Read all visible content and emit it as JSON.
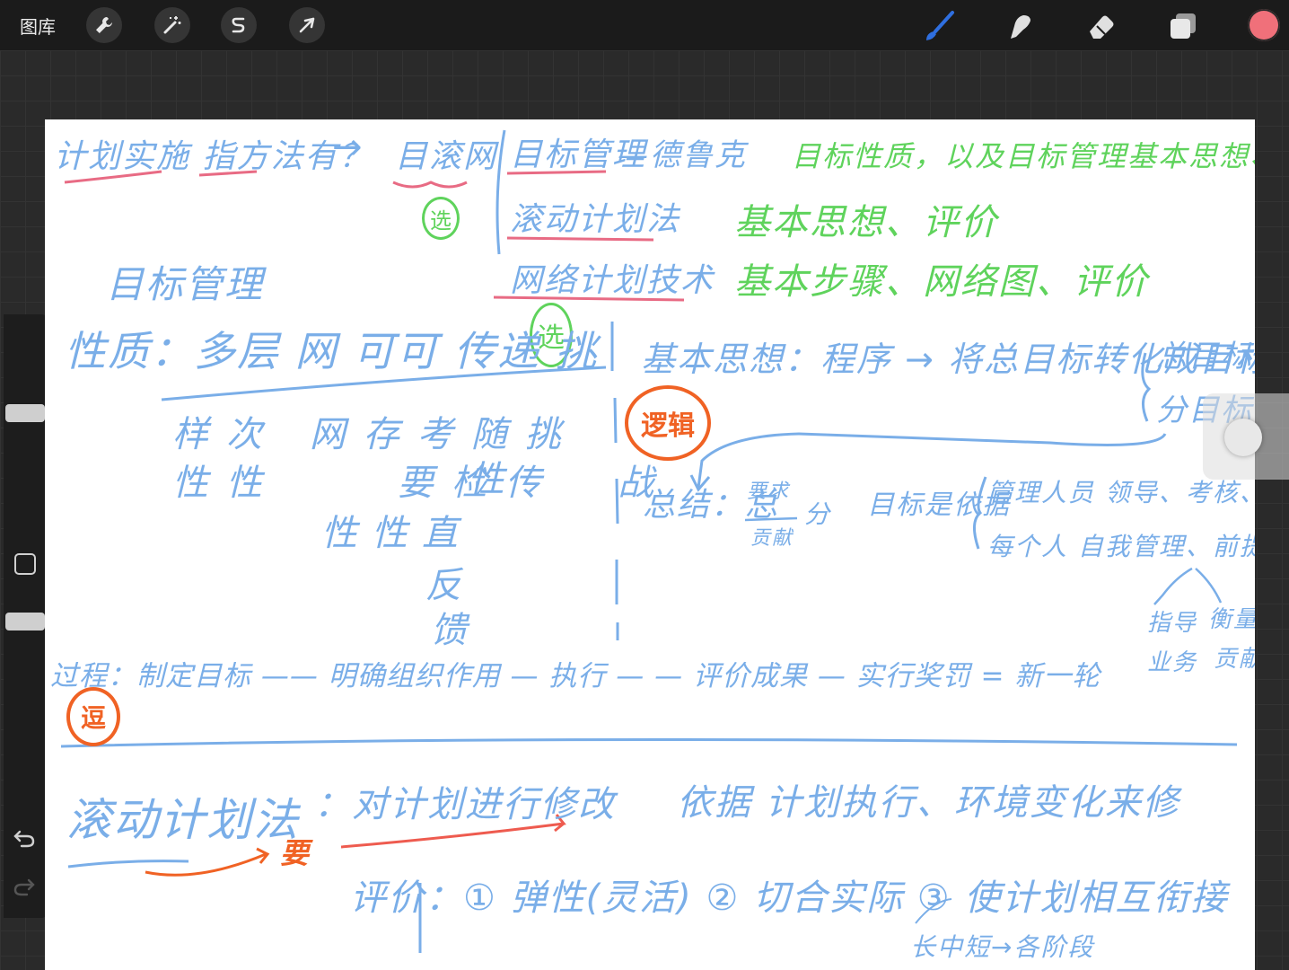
{
  "toolbar": {
    "gallery_label": "图库",
    "left_tools": [
      "wrench-icon",
      "magic-wand-icon",
      "selection-s-icon",
      "arrow-transform-icon"
    ],
    "right_tools": [
      "brush-icon",
      "smudge-icon",
      "eraser-icon",
      "layers-icon"
    ],
    "active_color": "#f0707a",
    "brush_accent": "#2f6fe0"
  },
  "sidebar": {
    "size_slider_level": 0.15,
    "opacity_slider_level": 0.5
  },
  "canvas": {
    "header": {
      "question": "计划实施 指方法有？",
      "arrow": "→",
      "targets": "目滚网",
      "item1": "目标管理",
      "item1_dash": "—德鲁克",
      "item1_note": "目标性质，以及目标管理基本思想、过程",
      "item2": "滚动计划法",
      "item2_note": "基本思想、评价",
      "item3": "网络计划技术",
      "item3_note": "基本步骤、网络图、评价"
    },
    "circle_choice_1": "选",
    "circle_choice_2": "选",
    "left_block": {
      "title": "目标管理",
      "nature_line": "性质：多层 网 可可 传递 挑",
      "row1": [
        "样",
        "次",
        "网",
        "存",
        "考",
        "随",
        "挑"
      ],
      "row2": [
        "性",
        "性",
        "要",
        "检",
        "传",
        "战"
      ],
      "row2b": "性",
      "row3": [
        "性",
        "性",
        "直"
      ],
      "vertical": [
        "反",
        "馈"
      ]
    },
    "right_block": {
      "thought": "基本思想：程序 → 将总目标转化成目标",
      "bracket_top": "总目标",
      "bracket_bottom": "分目标",
      "logic_badge": "逻辑",
      "summary_prefix": "总结：总",
      "fraction_top": "要求",
      "fraction_bottom": "贡献",
      "fraction_suffix": "分",
      "basis": "目标是依据",
      "basis_a": "管理人员  领导、考核、奖惩",
      "basis_b": "每个人  自我管理、前提(准则)",
      "fork_left_1": "指导",
      "fork_left_2": "业务",
      "fork_right_1": "衡量",
      "fork_right_2": "贡献"
    },
    "process": {
      "line": "过程：制定目标 —— 明确组织作用 — 执行 — — 评价成果 — 实行奖罚 = 新一轮",
      "badge": "逗"
    },
    "rolling": {
      "title": "滚动计划法",
      "colon_text": "：对计划进行修改",
      "basis": "依据 计划执行、环境变化来修",
      "important": "要",
      "evaluation": "评价：① 弹性(灵活) ② 切合实际 ③ 使计划相互衔接",
      "sub_note": "长中短→各阶段"
    }
  }
}
